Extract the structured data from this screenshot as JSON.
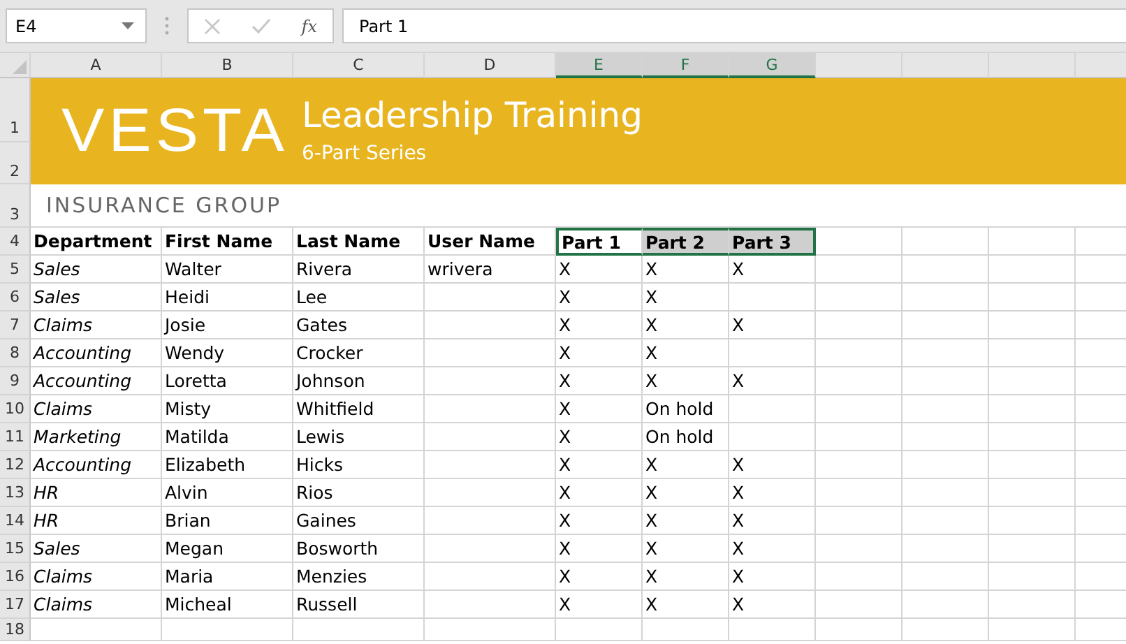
{
  "name_box": {
    "value": "E4"
  },
  "formula_bar": {
    "function_label": "fx",
    "value": "Part 1",
    "cancel_disabled": true,
    "enter_disabled": true
  },
  "columns": [
    {
      "label": "A",
      "selected": false
    },
    {
      "label": "B",
      "selected": false
    },
    {
      "label": "C",
      "selected": false
    },
    {
      "label": "D",
      "selected": false
    },
    {
      "label": "E",
      "selected": true
    },
    {
      "label": "F",
      "selected": true
    },
    {
      "label": "G",
      "selected": true
    }
  ],
  "banner": {
    "logo": "VESTA",
    "title": "Leadership Training",
    "subtitle": "6-Part Series",
    "tagline": "INSURANCE GROUP",
    "row_numbers": [
      "1",
      "2",
      "3"
    ]
  },
  "header_row": {
    "number": "4",
    "cells": [
      {
        "text": "Department",
        "selected": false,
        "active": false
      },
      {
        "text": "First Name",
        "selected": false,
        "active": false
      },
      {
        "text": "Last Name",
        "selected": false,
        "active": false
      },
      {
        "text": "User Name",
        "selected": false,
        "active": false
      },
      {
        "text": "Part 1",
        "selected": true,
        "active": true
      },
      {
        "text": "Part 2",
        "selected": true,
        "active": false
      },
      {
        "text": "Part 3",
        "selected": true,
        "active": false
      }
    ]
  },
  "rows": [
    {
      "number": "5",
      "cells": [
        "Sales",
        "Walter",
        "Rivera",
        "wrivera",
        "X",
        "X",
        "X"
      ]
    },
    {
      "number": "6",
      "cells": [
        "Sales",
        "Heidi",
        "Lee",
        null,
        "X",
        "X",
        null
      ]
    },
    {
      "number": "7",
      "cells": [
        "Claims",
        "Josie",
        "Gates",
        null,
        "X",
        "X",
        "X"
      ]
    },
    {
      "number": "8",
      "cells": [
        "Accounting",
        "Wendy",
        "Crocker",
        null,
        "X",
        "X",
        null
      ]
    },
    {
      "number": "9",
      "cells": [
        "Accounting",
        "Loretta",
        "Johnson",
        null,
        "X",
        "X",
        "X"
      ]
    },
    {
      "number": "10",
      "cells": [
        "Claims",
        "Misty",
        "Whitfield",
        null,
        "X",
        "On hold",
        null
      ]
    },
    {
      "number": "11",
      "cells": [
        "Marketing",
        "Matilda",
        "Lewis",
        null,
        "X",
        "On hold",
        null
      ]
    },
    {
      "number": "12",
      "cells": [
        "Accounting",
        "Elizabeth",
        "Hicks",
        null,
        "X",
        "X",
        "X"
      ]
    },
    {
      "number": "13",
      "cells": [
        "HR",
        "Alvin",
        "Rios",
        null,
        "X",
        "X",
        "X"
      ]
    },
    {
      "number": "14",
      "cells": [
        "HR",
        "Brian",
        "Gaines",
        null,
        "X",
        "X",
        "X"
      ]
    },
    {
      "number": "15",
      "cells": [
        "Sales",
        "Megan",
        "Bosworth",
        null,
        "X",
        "X",
        "X"
      ]
    },
    {
      "number": "16",
      "cells": [
        "Claims",
        "Maria",
        "Menzies",
        null,
        "X",
        "X",
        "X"
      ]
    },
    {
      "number": "17",
      "cells": [
        "Claims",
        "Micheal",
        "Russell",
        null,
        "X",
        "X",
        "X"
      ]
    },
    {
      "number": "18",
      "cells": [
        null,
        null,
        null,
        null,
        null,
        null,
        null
      ]
    }
  ]
}
